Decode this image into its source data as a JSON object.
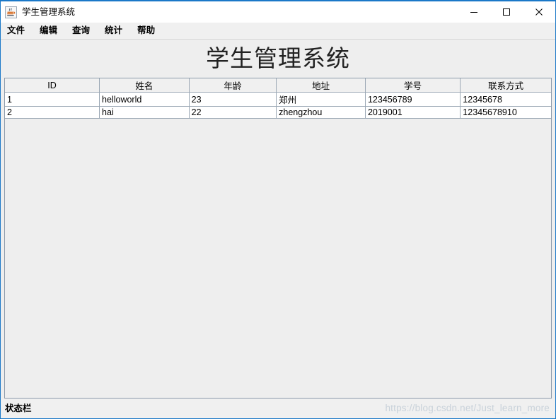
{
  "window": {
    "title": "学生管理系统",
    "icon": "java-cup-icon",
    "accent_color": "#1a78c8",
    "controls": [
      {
        "name": "minimize-button",
        "glyph": "—"
      },
      {
        "name": "maximize-button",
        "glyph": "☐"
      },
      {
        "name": "close-button",
        "glyph": "✕"
      }
    ]
  },
  "menu": {
    "items": [
      {
        "label": "文件"
      },
      {
        "label": "编辑"
      },
      {
        "label": "查询"
      },
      {
        "label": "统计"
      },
      {
        "label": "帮助"
      }
    ]
  },
  "main": {
    "heading": "学生管理系统",
    "table": {
      "columns": [
        "ID",
        "姓名",
        "年龄",
        "地址",
        "学号",
        "联系方式"
      ],
      "rows": [
        [
          "1",
          "helloworld",
          "23",
          "郑州",
          "123456789",
          "12345678"
        ],
        [
          "2",
          "hai",
          "22",
          "zhengzhou",
          "2019001",
          "12345678910"
        ]
      ]
    }
  },
  "status": {
    "text": "状态栏"
  },
  "watermark": {
    "text": "https://blog.csdn.net/Just_learn_more"
  }
}
